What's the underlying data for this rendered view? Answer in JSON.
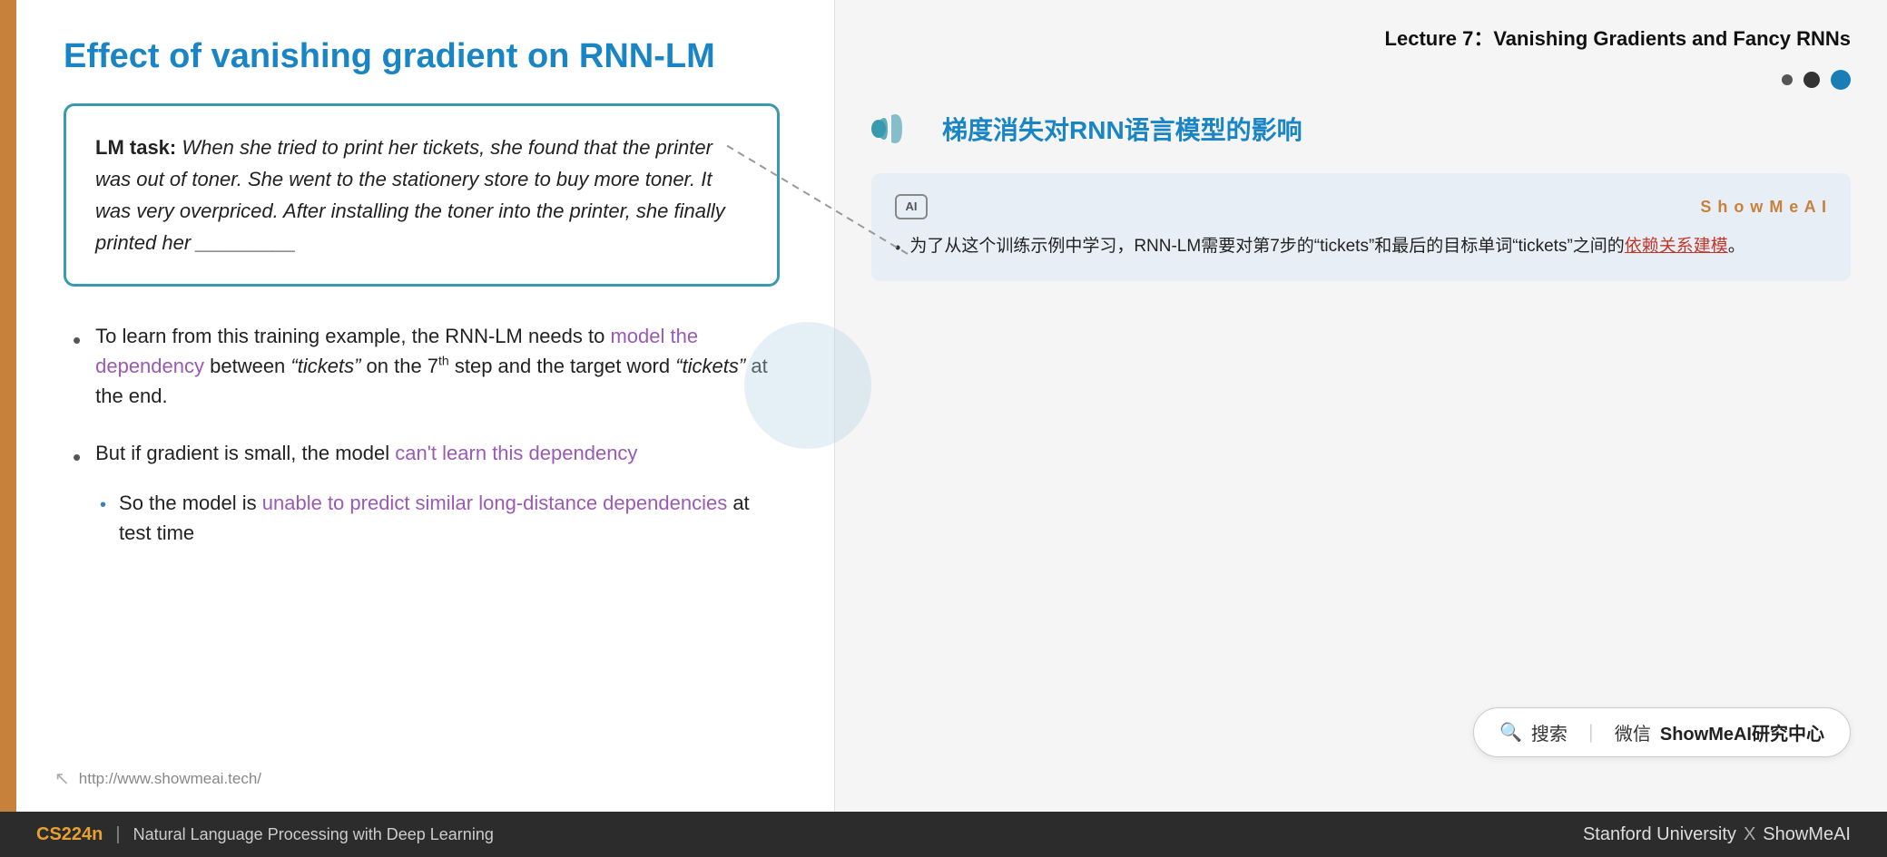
{
  "slide": {
    "left_bar_color": "#c8813a",
    "title": "Effect of vanishing gradient on RNN-LM",
    "lm_task": {
      "label": "LM task:",
      "text": " When she tried to print her tickets, she found that the printer was out of toner. She went to the stationery store to buy more toner. It was very overpriced. After installing the toner into the printer, she finally printed her _________"
    },
    "bullet1": {
      "dot": "•",
      "text_before": "To learn from this training example, the RNN-LM needs to ",
      "purple_text": "model the dependency",
      "text_middle": " between ",
      "italic1": "“tickets”",
      "text_after1": " on the 7",
      "superscript": "th",
      "text_after2": " step and the target word ",
      "italic2": "“tickets”",
      "text_end": " at the end."
    },
    "bullet2": {
      "dot": "•",
      "text_before": "But if gradient is small, the model ",
      "purple_text": "can't learn this dependency",
      "sub_dot": "•",
      "sub_text_before": "So the model is ",
      "sub_purple": "unable to predict similar long-distance dependencies",
      "sub_text_after": " at test time"
    },
    "footer": {
      "url": "http://www.showmeai.tech/"
    }
  },
  "right_panel": {
    "lecture_title": "Lecture 7：Vanishing Gradients and Fancy RNNs",
    "dots": [
      "small",
      "medium",
      "large"
    ],
    "chinese_title": "梯度消失对RNN语言模型的影响",
    "ai_box": {
      "ai_icon_text": "AI",
      "showmeai_label": "S h o w M e A I",
      "bullet": "•",
      "text_before": "为了从这个训练示例中学习，RNN-LM需要对第7步的“tickets”和最后的目标单词“tickets”之间的",
      "red_text": "依赖关系建模",
      "text_after": "。"
    },
    "search_box": {
      "icon": "🔍",
      "divider": "|",
      "text_before": "搜索",
      "separator": "微信",
      "bold_text": "ShowMeAI研究中心"
    }
  },
  "bottom_bar": {
    "cs224n": "CS224n",
    "separator": "|",
    "subtitle": "Natural Language Processing with Deep Learning",
    "stanford": "Stanford University",
    "x": "X",
    "showmeai": "ShowMeAI"
  }
}
